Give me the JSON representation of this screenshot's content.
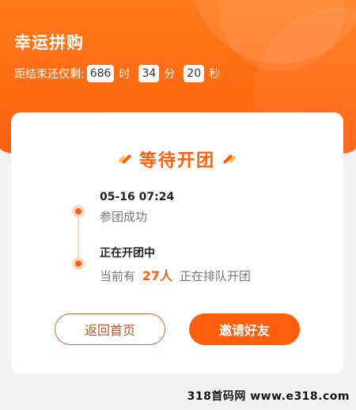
{
  "header": {
    "title": "幸运拼购",
    "countdown": {
      "prefix": "距结束还仅剩:",
      "hours": "686",
      "hours_unit": "时",
      "minutes": "34",
      "minutes_unit": "分",
      "seconds": "20",
      "seconds_unit": "秒"
    }
  },
  "card": {
    "title": "等待开团",
    "timeline": [
      {
        "heading": "05-16 07:24",
        "sub": "参团成功"
      },
      {
        "heading": "正在开团中",
        "sub_prefix": "当前有",
        "count": "27人",
        "sub_suffix": "正在排队开团"
      }
    ],
    "buttons": {
      "back": "返回首页",
      "invite": "邀请好友"
    }
  },
  "watermark": "318首码网 www.e318.com",
  "colors": {
    "accent": "#ff5e0d",
    "accent_light": "#ffd7c2"
  }
}
